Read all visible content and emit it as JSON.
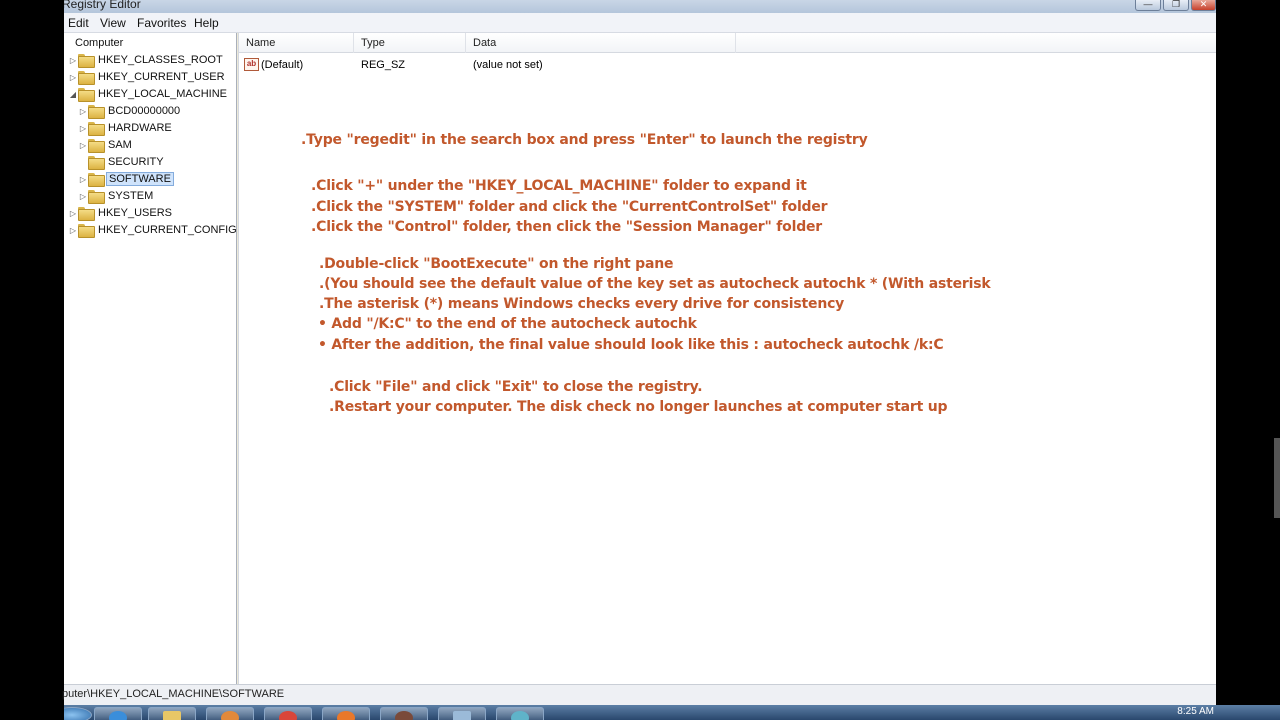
{
  "window": {
    "title": "Registry Editor",
    "minimize_glyph": "—",
    "maximize_glyph": "❐",
    "close_glyph": "✕"
  },
  "menu": [
    "Edit",
    "View",
    "Favorites",
    "Help"
  ],
  "tree": {
    "root": "Computer",
    "items": [
      {
        "label": "HKEY_CLASSES_ROOT",
        "expander": "▷"
      },
      {
        "label": "HKEY_CURRENT_USER",
        "expander": "▷"
      },
      {
        "label": "HKEY_LOCAL_MACHINE",
        "expander": "◢"
      },
      {
        "label": "BCD00000000",
        "expander": "▷"
      },
      {
        "label": "HARDWARE",
        "expander": "▷"
      },
      {
        "label": "SAM",
        "expander": "▷"
      },
      {
        "label": "SECURITY",
        "expander": ""
      },
      {
        "label": "SOFTWARE",
        "expander": "▷"
      },
      {
        "label": "SYSTEM",
        "expander": "▷"
      },
      {
        "label": "HKEY_USERS",
        "expander": "▷"
      },
      {
        "label": "HKEY_CURRENT_CONFIG",
        "expander": "▷"
      }
    ],
    "selected": "SOFTWARE"
  },
  "columns": [
    "Name",
    "Type",
    "Data"
  ],
  "values": [
    {
      "icon": "ab",
      "name": "(Default)",
      "type": "REG_SZ",
      "data": "(value not set)"
    }
  ],
  "instructions": [
    ".Type \"regedit\" in the search box and press \"Enter\" to launch the registry",
    ".Click \"+\" under the \"HKEY_LOCAL_MACHINE\" folder to expand it",
    ".Click the \"SYSTEM\" folder and click the \"CurrentControlSet\" folder",
    ".Click the \"Control\" folder, then click the \"Session Manager\" folder",
    ".Double-click \"BootExecute\" on the right pane",
    ".(You should see the default value of the key set as autocheck autochk * (With asterisk",
    ".The asterisk (*) means Windows checks every drive for consistency",
    "• Add \"/K:C\" to the end of the autocheck autochk",
    "• After the addition, the final value should look like this : autocheck autochk /k:C",
    ".Click \"File\" and click \"Exit\" to close the registry.",
    ".Restart your computer. The disk check no longer launches at computer start up"
  ],
  "statusbar": "puter\\HKEY_LOCAL_MACHINE\\SOFTWARE",
  "taskbar": {
    "clock": "8:25 AM",
    "icons": [
      "ie-icon",
      "folder-icon",
      "media-icon",
      "chrome-icon",
      "firefox-icon",
      "tv-icon",
      "notepad-icon",
      "network-icon"
    ]
  }
}
